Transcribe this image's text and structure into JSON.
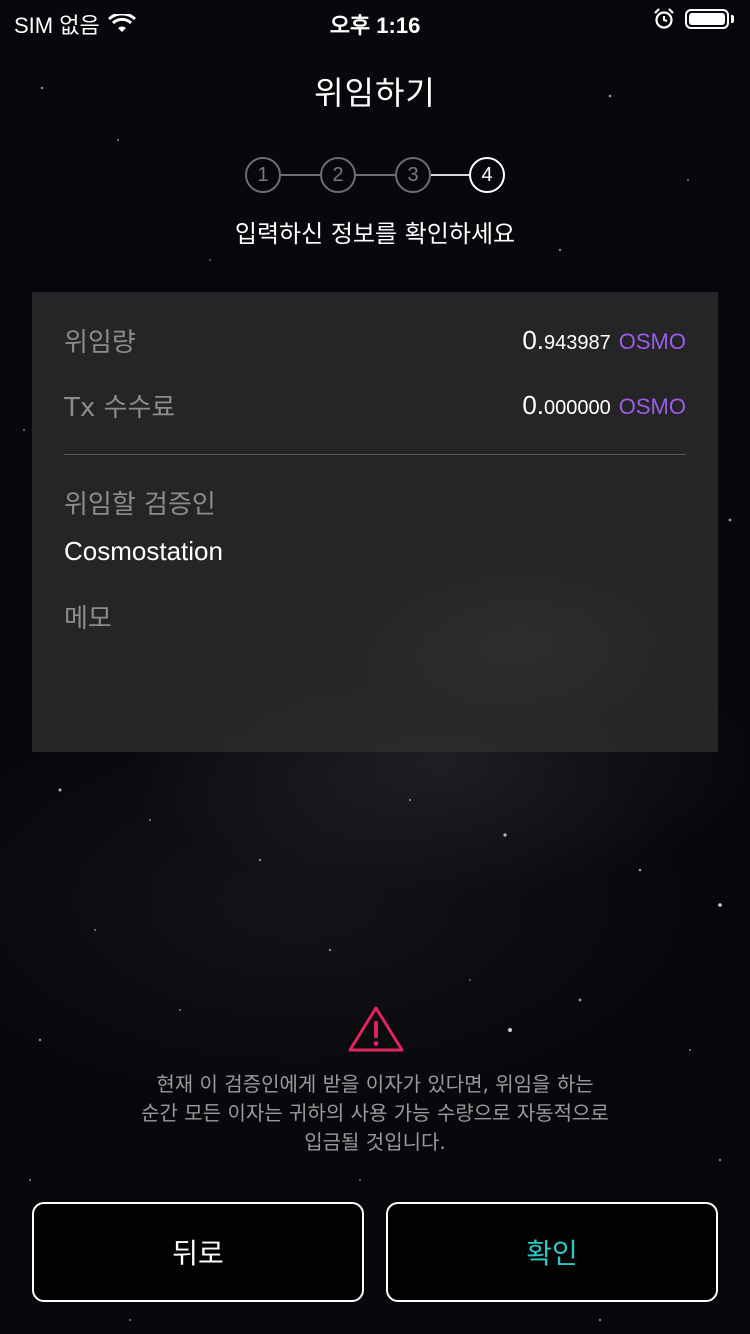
{
  "status_bar": {
    "carrier": "SIM 없음",
    "time": "오후 1:16",
    "icons": [
      "wifi-icon",
      "alarm-icon",
      "battery-icon"
    ]
  },
  "header": {
    "title": "위임하기"
  },
  "stepper": {
    "steps": [
      "1",
      "2",
      "3",
      "4"
    ],
    "current_step": 4
  },
  "subtitle": "입력하신 정보를 확인하세요",
  "summary": {
    "delegation_amount": {
      "label": "위임량",
      "int": "0.",
      "decimals": "943987",
      "denom": "OSMO"
    },
    "tx_fee": {
      "label": "Tx 수수료",
      "int": "0.",
      "decimals": "000000",
      "denom": "OSMO"
    },
    "validator": {
      "label": "위임할 검증인",
      "name": "Cosmostation"
    },
    "memo": {
      "label": "메모",
      "value": ""
    }
  },
  "warning": {
    "icon": "warning-triangle-icon",
    "line1": "현재 이 검증인에게 받을 이자가 있다면, 위임을 하는",
    "line2": "순간 모든 이자는 귀하의 사용 가능 수량으로 자동적으로",
    "line3": "입금될 것입니다."
  },
  "buttons": {
    "back_label": "뒤로",
    "confirm_label": "확인"
  },
  "colors": {
    "denom": "#9b5de5",
    "confirm_text": "#2fc7c7",
    "warning_icon": "#e0245e"
  }
}
